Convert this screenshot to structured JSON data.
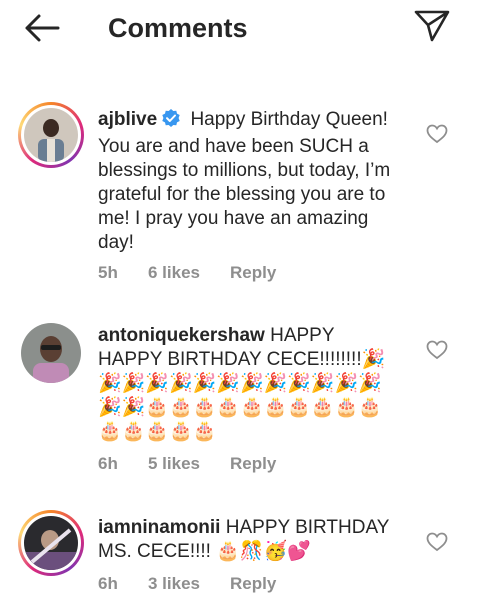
{
  "header": {
    "title": "Comments",
    "back_icon": "arrow-left-icon",
    "share_icon": "paper-plane-icon"
  },
  "comments": [
    {
      "username": "ajblive",
      "verified": true,
      "text": "Happy Birthday Queen!  You are and have been SUCH a blessings to millions, but today, I’m grateful for the blessing you are to me!  I pray you have an amazing day!",
      "time": "5h",
      "likes": "6 likes",
      "reply": "Reply",
      "story_ring": true
    },
    {
      "username": "antoniquekershaw",
      "verified": false,
      "text": "HAPPY HAPPY BIRTHDAY CECE!!!!!!!!🎉🎉🎉🎉🎉🎉🎉🎉🎉🎉🎉🎉🎉🎉🎉🎂🎂🎂🎂🎂🎂🎂🎂🎂🎂🎂🎂🎂🎂🎂",
      "time": "6h",
      "likes": "5 likes",
      "reply": "Reply",
      "story_ring": false
    },
    {
      "username": "iamninamonii",
      "verified": false,
      "text": "HAPPY BIRTHDAY MS. CECE!!!! 🎂🎊🥳💕",
      "time": "6h",
      "likes": "3 likes",
      "reply": "Reply",
      "story_ring": true
    }
  ],
  "colors": {
    "text": "#262626",
    "secondary": "#8e8e8e",
    "verified": "#3897f0"
  }
}
